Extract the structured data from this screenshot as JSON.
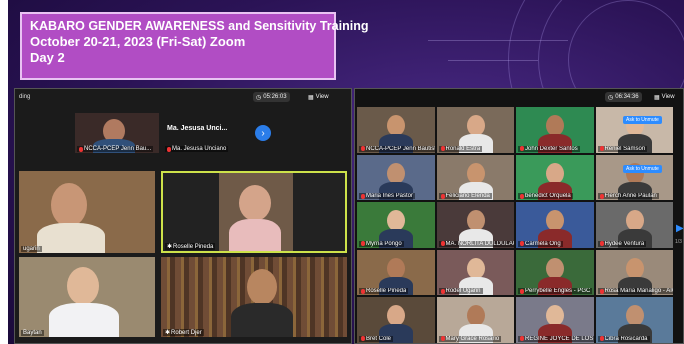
{
  "title": {
    "line1": "KABARO GENDER AWARENESS  and Sensitivity Training",
    "line2": "October  20-21, 2023 (Fri-Sat) Zoom",
    "line3": "Day 2"
  },
  "left_window": {
    "status": "ding",
    "timer": "05:26:03",
    "view_label": "View",
    "top_strip": [
      {
        "name": "NCCA-PCEP Jenn Bau..."
      },
      {
        "name": "Ma. Jesusa Unciano",
        "big_name": "Ma. Jesusa Unci..."
      }
    ],
    "next_icon": "›",
    "tiles": [
      {
        "name": "ugarin"
      },
      {
        "name": "Roselle Pineda"
      },
      {
        "name": "Baytan"
      },
      {
        "name": "Robert Djer"
      }
    ]
  },
  "right_window": {
    "timer": "06:34:36",
    "view_label": "View",
    "unmute_label": "Ask to Unmute",
    "page_indicator": "1/3",
    "tiles": [
      "NCCA-PCEP Jenn Bautista",
      "Ronald Estra",
      "John Dexter Santos",
      "Reniel Samson",
      "Maria Ines Pastor",
      "Feliciano Elenda",
      "benedict Orquela",
      "Flerch Anne Paulan",
      "Myrna Pongo",
      "MA. NORLITA DULDULAO",
      "Carmela Ong",
      "Hydee Ventura",
      "Roselle Pineda",
      "Rodel Ugarin",
      "Perrybelle Engles - PGC",
      "Rosa Maria Manaligo - AIC Ca...",
      "Bret Cole",
      "Mary Grace Rosario",
      "REGINE JOYCE DE LOS SANTOS",
      "Cibra Rosicarda"
    ]
  },
  "colors": {
    "slide_bg": "#2b1356",
    "title_bg": "#b14dc4",
    "accent_blue": "#2d8cff",
    "active_speaker": "#cde24a"
  }
}
